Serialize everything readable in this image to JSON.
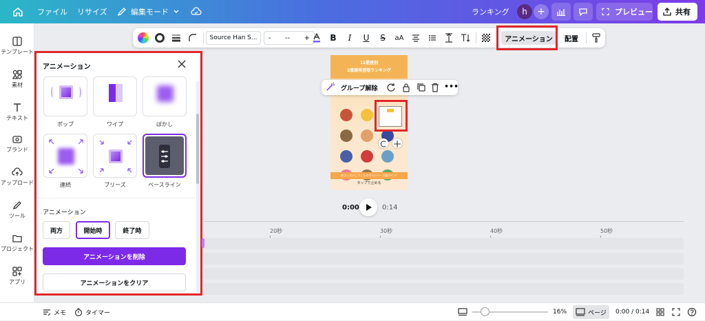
{
  "topbar": {
    "file": "ファイル",
    "resize": "リサイズ",
    "edit_mode": "編集モード",
    "ranking": "ランキング",
    "avatar": "h",
    "preview": "プレビュー",
    "share": "共有"
  },
  "rail": {
    "items": [
      {
        "label": "テンプレート"
      },
      {
        "label": "素材"
      },
      {
        "label": "テキスト"
      },
      {
        "label": "ブランド"
      },
      {
        "label": "アップロード"
      },
      {
        "label": "ツール"
      },
      {
        "label": "プロジェクト"
      },
      {
        "label": "アプリ"
      }
    ]
  },
  "toolbar": {
    "font": "Source Han S...",
    "minus": "-",
    "size": "--",
    "plus": "+",
    "bold": "B",
    "italic": "I",
    "underline": "U",
    "strike": "S",
    "case": "aA",
    "animation": "アニメーション",
    "position": "配置"
  },
  "panel": {
    "title": "アニメーション",
    "tiles": [
      {
        "label": "ポップ"
      },
      {
        "label": "ワイプ"
      },
      {
        "label": "ぼかし"
      },
      {
        "label": "連続"
      },
      {
        "label": "ブリーズ"
      },
      {
        "label": "ベースライン"
      }
    ],
    "section_title": "アニメーション",
    "segments": [
      "両方",
      "開始時",
      "終了時"
    ],
    "delete_button": "アニメーションを削除",
    "clear_button": "アニメーションをクリア"
  },
  "floating_toolbar": {
    "ungroup": "グループ解除"
  },
  "design": {
    "header_line1": "12星座別",
    "header_line2": "2度振発音短ランキング",
    "footer": "向きしろいこうしたのボメンバーズ族ボイン!",
    "tap": "タップで止める"
  },
  "playback": {
    "current": "0:00",
    "total": "0:14"
  },
  "timeline": {
    "ticks": [
      "20秒",
      "30秒",
      "40秒",
      "50秒"
    ]
  },
  "bottombar": {
    "notes": "メモ",
    "timer": "タイマー",
    "zoom": "16%",
    "page": "ページ",
    "time": "0:00 / 0:14"
  },
  "colors": {
    "accent_purple": "#7d2ae8",
    "highlight_red": "#e0262a"
  }
}
